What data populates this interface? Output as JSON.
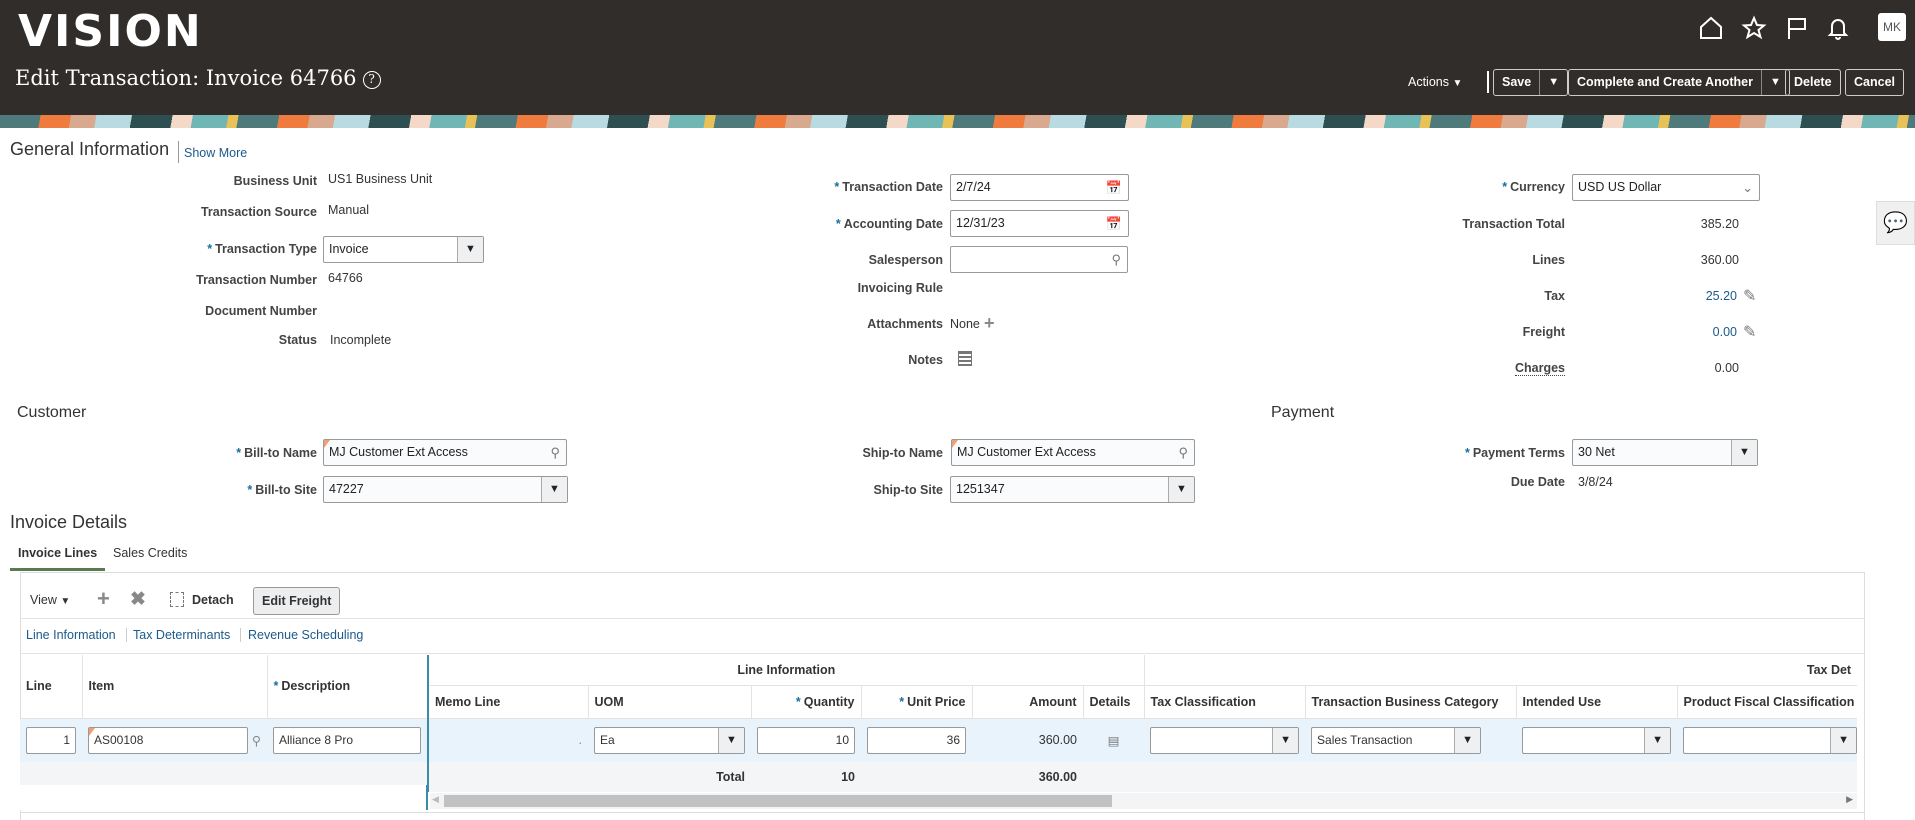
{
  "app": {
    "logo": "VISION",
    "page_title": "Edit Transaction: Invoice 64766",
    "user_initials": "MK"
  },
  "header_icons": [
    "home-icon",
    "star-icon",
    "flag-icon",
    "bell-icon"
  ],
  "toolbar": {
    "actions": "Actions",
    "save": "Save",
    "complete": "Complete and Create Another",
    "delete": "Delete",
    "cancel": "Cancel"
  },
  "general": {
    "title": "General Information",
    "show_more": "Show More",
    "business_unit": {
      "label": "Business Unit",
      "value": "US1 Business Unit"
    },
    "transaction_source": {
      "label": "Transaction Source",
      "value": "Manual"
    },
    "transaction_type": {
      "label": "Transaction Type",
      "value": "Invoice"
    },
    "transaction_number": {
      "label": "Transaction Number",
      "value": "64766"
    },
    "document_number": {
      "label": "Document Number",
      "value": ""
    },
    "status": {
      "label": "Status",
      "value": "Incomplete"
    },
    "transaction_date": {
      "label": "Transaction Date",
      "value": "2/7/24"
    },
    "accounting_date": {
      "label": "Accounting Date",
      "value": "12/31/23"
    },
    "salesperson": {
      "label": "Salesperson",
      "value": ""
    },
    "invoicing_rule": {
      "label": "Invoicing Rule"
    },
    "attachments": {
      "label": "Attachments",
      "value": "None"
    },
    "notes": {
      "label": "Notes"
    },
    "currency": {
      "label": "Currency",
      "value": "USD US Dollar"
    },
    "transaction_total": {
      "label": "Transaction Total",
      "value": "385.20"
    },
    "lines": {
      "label": "Lines",
      "value": "360.00"
    },
    "tax": {
      "label": "Tax",
      "value": "25.20"
    },
    "freight": {
      "label": "Freight",
      "value": "0.00"
    },
    "charges": {
      "label": "Charges",
      "value": "0.00"
    }
  },
  "customer": {
    "title": "Customer",
    "bill_to_name": {
      "label": "Bill-to Name",
      "value": "MJ Customer Ext Access"
    },
    "bill_to_site": {
      "label": "Bill-to Site",
      "value": "47227"
    },
    "ship_to_name": {
      "label": "Ship-to Name",
      "value": "MJ Customer Ext Access"
    },
    "ship_to_site": {
      "label": "Ship-to Site",
      "value": "1251347"
    }
  },
  "payment": {
    "title": "Payment",
    "terms": {
      "label": "Payment Terms",
      "value": "30 Net"
    },
    "due_date": {
      "label": "Due Date",
      "value": "3/8/24"
    }
  },
  "invoice_details": {
    "title": "Invoice Details",
    "tabs": [
      "Invoice Lines",
      "Sales Credits"
    ],
    "view": "View",
    "detach": "Detach",
    "edit_freight": "Edit Freight",
    "subtabs": [
      "Line Information",
      "Tax Determinants",
      "Revenue Scheduling"
    ],
    "groups": {
      "line_info": "Line Information",
      "tax_det": "Tax Det"
    },
    "columns": {
      "line": "Line",
      "item": "Item",
      "description": "Description",
      "memo_line": "Memo Line",
      "uom": "UOM",
      "quantity": "Quantity",
      "unit_price": "Unit Price",
      "amount": "Amount",
      "details": "Details",
      "tax_classification": "Tax Classification",
      "tbc": "Transaction Business Category",
      "intended_use": "Intended Use",
      "product_fiscal": "Product Fiscal Classification"
    },
    "rows": [
      {
        "line": "1",
        "item": "AS00108",
        "description": "Alliance 8 Pro",
        "memo_line": ".",
        "uom": "Ea",
        "quantity": "10",
        "unit_price": "36",
        "amount": "360.00",
        "tax_classification": "",
        "tbc": "Sales Transaction",
        "intended_use": "",
        "product_fiscal": ""
      }
    ],
    "totals": {
      "label": "Total",
      "quantity": "10",
      "amount": "360.00"
    }
  }
}
